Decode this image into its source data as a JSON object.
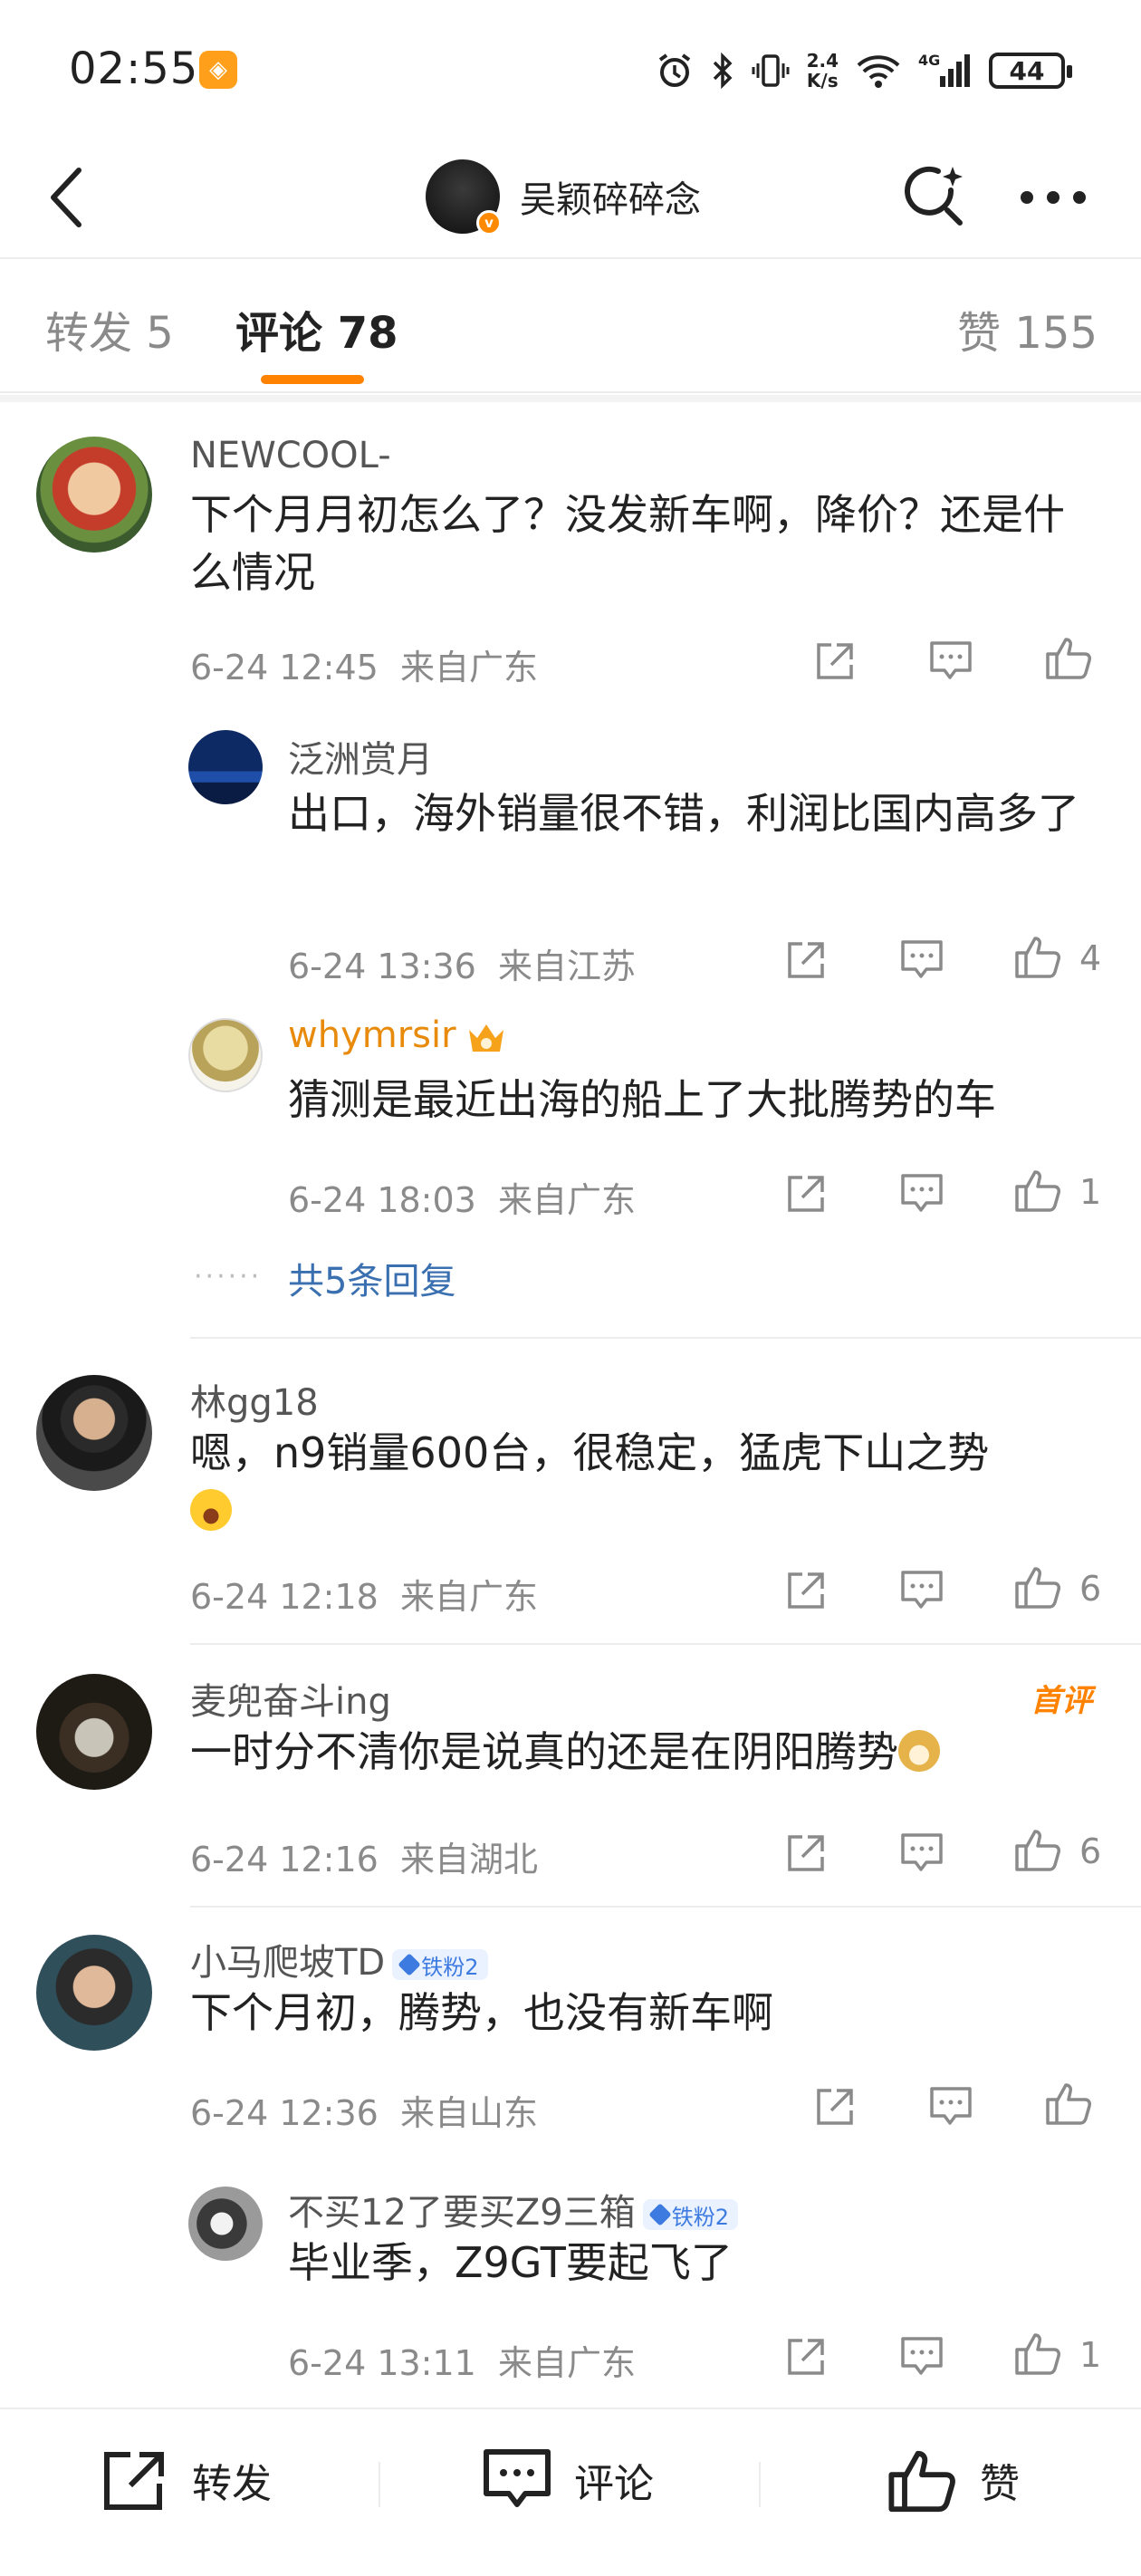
{
  "status_bar": {
    "time": "02:55",
    "net_speed_value": "2.4",
    "net_speed_unit": "K/s",
    "network": "4G",
    "battery": "44"
  },
  "header": {
    "title": "吴颖碎碎念"
  },
  "tabs": {
    "repost": "转发 5",
    "comment": "评论 78",
    "like": "赞 155"
  },
  "comments": [
    {
      "user": "NEWCOOL-",
      "text": "下个月月初怎么了？没发新车啊，降价？还是什么情况",
      "time": "6-24 12:45",
      "location": "来自广东",
      "likes": "",
      "replies": [
        {
          "user": "泛洲赏月",
          "text": "出口，海外销量很不错，利润比国内高多了",
          "time": "6-24 13:36",
          "location": "来自江苏",
          "likes": "4"
        },
        {
          "user": "whymrsir",
          "text": "猜测是最近出海的船上了大批腾势的车",
          "time": "6-24 18:03",
          "location": "来自广东",
          "likes": "1"
        }
      ],
      "more_replies": "共5条回复"
    },
    {
      "user": "林gg18",
      "text": "嗯，n9销量600台，很稳定，猛虎下山之势",
      "time": "6-24 12:18",
      "location": "来自广东",
      "likes": "6"
    },
    {
      "user": "麦兜奋斗ing",
      "badge": "首评",
      "text": "一时分不清你是说真的还是在阴阳腾势",
      "time": "6-24 12:16",
      "location": "来自湖北",
      "likes": "6"
    },
    {
      "user": "小马爬坡TD",
      "fan_badge": "铁粉2",
      "text": "下个月初，腾势，也没有新车啊",
      "time": "6-24 12:36",
      "location": "来自山东",
      "likes": "",
      "replies": [
        {
          "user": "不买12了要买Z9三箱",
          "fan_badge": "铁粉2",
          "text": "毕业季，Z9GT要起飞了",
          "time": "6-24 13:11",
          "location": "来自广东",
          "likes": "1"
        }
      ]
    }
  ],
  "bottom_bar": {
    "repost": "转发",
    "comment": "评论",
    "like": "赞"
  },
  "colors": {
    "accent": "#ff8200",
    "link": "#3a6fb0",
    "gold_name": "#e88a0c",
    "fan_badge": "#3d7be0"
  }
}
